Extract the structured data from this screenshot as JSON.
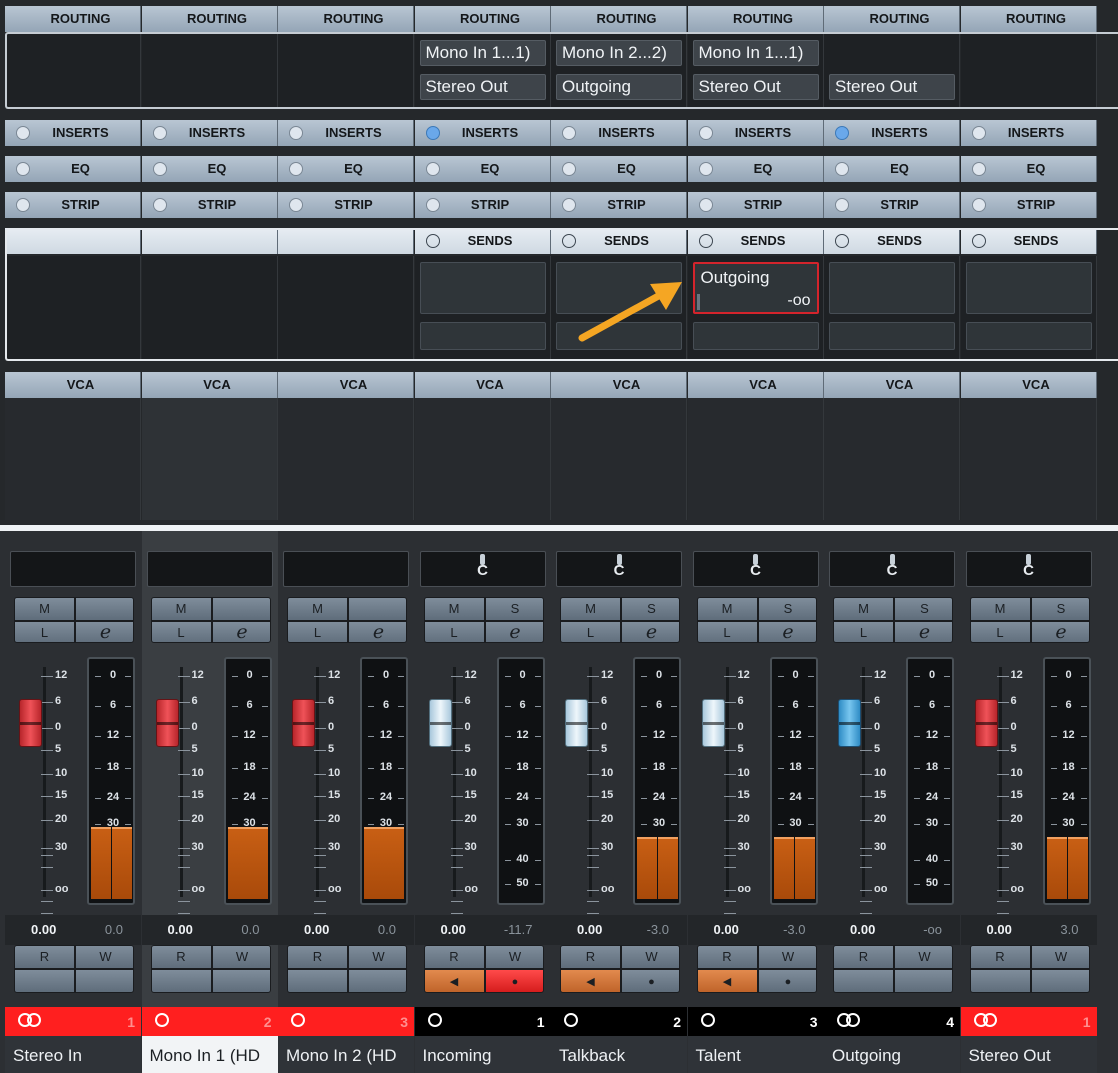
{
  "rack": {
    "routing_label": "ROUTING",
    "inserts_label": "INSERTS",
    "eq_label": "EQ",
    "strip_label": "STRIP",
    "sends_label": "SENDS",
    "vca_label": "VCA",
    "routing_inputs": [
      "",
      "",
      "",
      "Mono In 1...1)",
      "Mono In 2...2)",
      "Mono In 1...1)",
      "",
      ""
    ],
    "routing_outputs": [
      "",
      "",
      "",
      "Stereo Out",
      "Outgoing",
      "Stereo Out",
      "Stereo Out",
      ""
    ],
    "inserts_active": [
      false,
      false,
      false,
      true,
      false,
      false,
      true,
      false
    ],
    "has_sends": [
      false,
      false,
      false,
      true,
      true,
      true,
      true,
      true
    ],
    "active_send": {
      "channel_index": 5,
      "target": "Outgoing",
      "level": "-oo"
    }
  },
  "annotation": {
    "arrow_color": "#f5a623"
  },
  "mixer": {
    "channels": [
      {
        "name": "Stereo In",
        "pan": "",
        "show_pan": true,
        "fader": "0.00",
        "peak": "0.0",
        "cap": "red",
        "number": "1",
        "type": "stereo",
        "strip_color": "#ff1f1f",
        "meter_ticks": [
          "0",
          "6",
          "12",
          "18",
          "24",
          "30"
        ],
        "meter_level": 0.3,
        "stereo": true,
        "selected": false
      },
      {
        "name": "Mono In 1 (HD",
        "pan": "",
        "show_pan": false,
        "fader": "0.00",
        "peak": "0.0",
        "cap": "red",
        "number": "2",
        "type": "mono",
        "strip_color": "#ff1f1f",
        "meter_ticks": [
          "0",
          "6",
          "12",
          "18",
          "24",
          "30"
        ],
        "meter_level": 0.3,
        "stereo": false,
        "selected": true
      },
      {
        "name": "Mono In 2 (HD",
        "pan": "",
        "show_pan": false,
        "fader": "0.00",
        "peak": "0.0",
        "cap": "red",
        "number": "3",
        "type": "mono",
        "strip_color": "#ff1f1f",
        "meter_ticks": [
          "0",
          "6",
          "12",
          "18",
          "24",
          "30"
        ],
        "meter_level": 0.3,
        "stereo": false,
        "selected": false
      },
      {
        "name": "Incoming",
        "pan": "C",
        "show_pan": true,
        "fader": "0.00",
        "peak": "-11.7",
        "cap": "white",
        "number": "1",
        "type": "mono",
        "strip_color": "#000000",
        "meter_ticks": [
          "0",
          "6",
          "12",
          "18",
          "24",
          "30",
          "40",
          "50"
        ],
        "meter_level": 0,
        "stereo": false,
        "selected": false
      },
      {
        "name": "Talkback",
        "pan": "C",
        "show_pan": true,
        "fader": "0.00",
        "peak": "-3.0",
        "cap": "white",
        "number": "2",
        "type": "mono",
        "strip_color": "#000000",
        "meter_ticks": [
          "0",
          "6",
          "12",
          "18",
          "24",
          "30"
        ],
        "meter_level": 0.26,
        "stereo": true,
        "selected": false
      },
      {
        "name": "Talent",
        "pan": "C",
        "show_pan": true,
        "fader": "0.00",
        "peak": "-3.0",
        "cap": "white",
        "number": "3",
        "type": "mono",
        "strip_color": "#000000",
        "meter_ticks": [
          "0",
          "6",
          "12",
          "18",
          "24",
          "30"
        ],
        "meter_level": 0.26,
        "stereo": true,
        "selected": false
      },
      {
        "name": "Outgoing",
        "pan": "C",
        "show_pan": true,
        "fader": "0.00",
        "peak": "-oo",
        "cap": "blue",
        "number": "4",
        "type": "stereo",
        "strip_color": "#000000",
        "meter_ticks": [
          "0",
          "6",
          "12",
          "18",
          "24",
          "30",
          "40",
          "50"
        ],
        "meter_level": 0,
        "stereo": false,
        "selected": false
      },
      {
        "name": "Stereo Out",
        "pan": "C",
        "show_pan": true,
        "fader": "0.00",
        "peak": "3.0",
        "cap": "red",
        "number": "1",
        "type": "stereo",
        "strip_color": "#ff1f1f",
        "meter_ticks": [
          "0",
          "6",
          "12",
          "18",
          "24",
          "30"
        ],
        "meter_level": 0.26,
        "stereo": true,
        "selected": false
      }
    ],
    "fader_scale": [
      "12",
      "6",
      "0",
      "5",
      "10",
      "15",
      "20",
      "30",
      "oo"
    ],
    "buttons": {
      "mute": "M",
      "solo": "S",
      "listen": "L",
      "edit": "e",
      "read": "R",
      "write": "W"
    },
    "rw_active": [
      false,
      false,
      false,
      true,
      true,
      true,
      false,
      false
    ],
    "rec_active": [
      false,
      false,
      false,
      true,
      false,
      false,
      false,
      false
    ],
    "solo_shown": [
      false,
      false,
      false,
      true,
      true,
      true,
      true,
      true
    ]
  }
}
